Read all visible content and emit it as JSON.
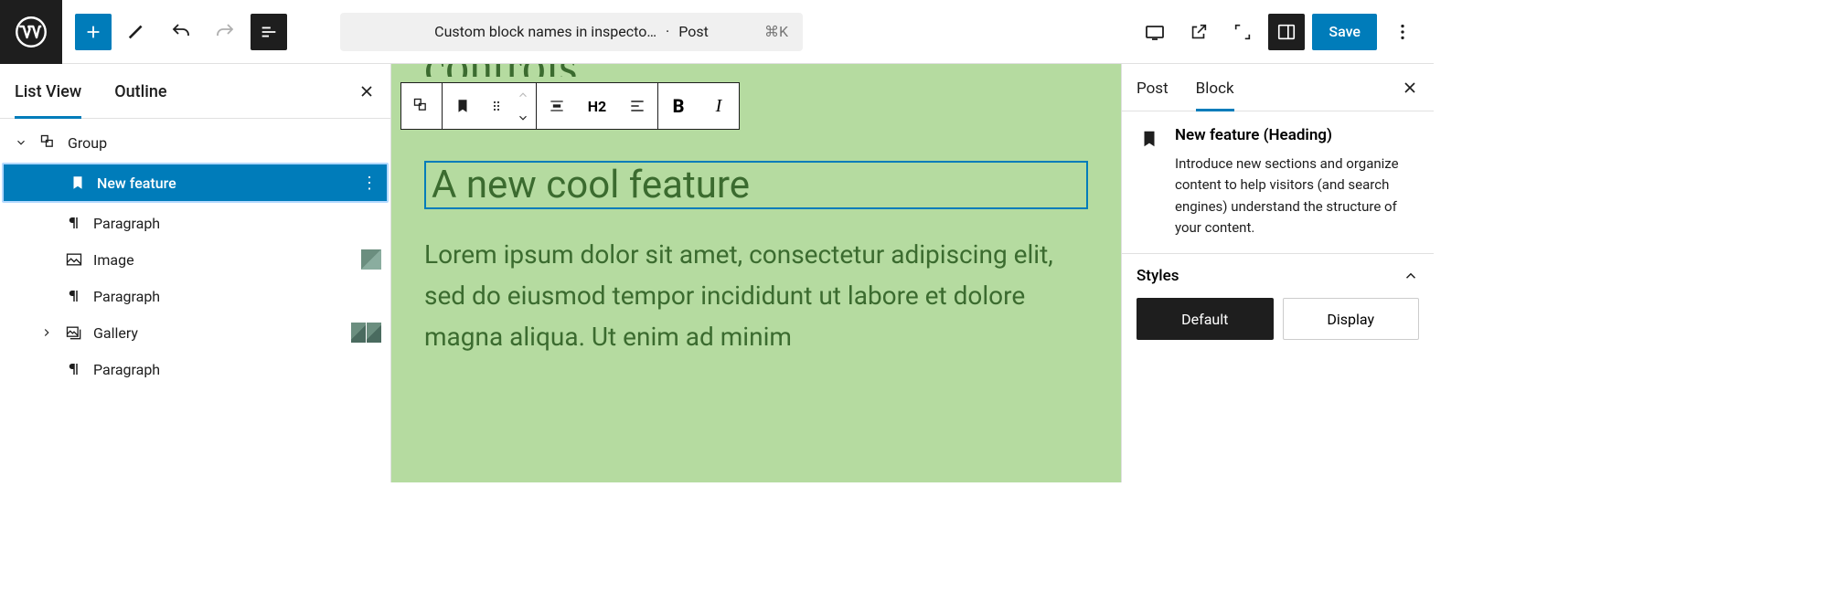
{
  "topbar": {
    "document_title": "Custom block names in inspecto…",
    "document_type": "Post",
    "shortcut": "⌘K",
    "save_label": "Save"
  },
  "left_panel": {
    "tabs": {
      "list_view": "List View",
      "outline": "Outline"
    },
    "tree": {
      "group": "Group",
      "items": [
        {
          "label": "New feature"
        },
        {
          "label": "Paragraph"
        },
        {
          "label": "Image"
        },
        {
          "label": "Paragraph"
        },
        {
          "label": "Gallery"
        },
        {
          "label": "Paragraph"
        }
      ]
    }
  },
  "toolbar": {
    "heading_level": "H2"
  },
  "canvas": {
    "partial_above": "controls",
    "heading_text": "A new cool feature",
    "paragraph_text": "Lorem ipsum dolor sit amet, consectetur adipiscing elit, sed do eiusmod tempor incididunt ut labore et dolore magna aliqua. Ut enim ad minim"
  },
  "right_panel": {
    "tabs": {
      "post": "Post",
      "block": "Block"
    },
    "block_title": "New feature (Heading)",
    "block_description": "Introduce new sections and organize content to help visitors (and search engines) understand the structure of your content.",
    "styles_label": "Styles",
    "variants": {
      "default": "Default",
      "display": "Display"
    }
  }
}
